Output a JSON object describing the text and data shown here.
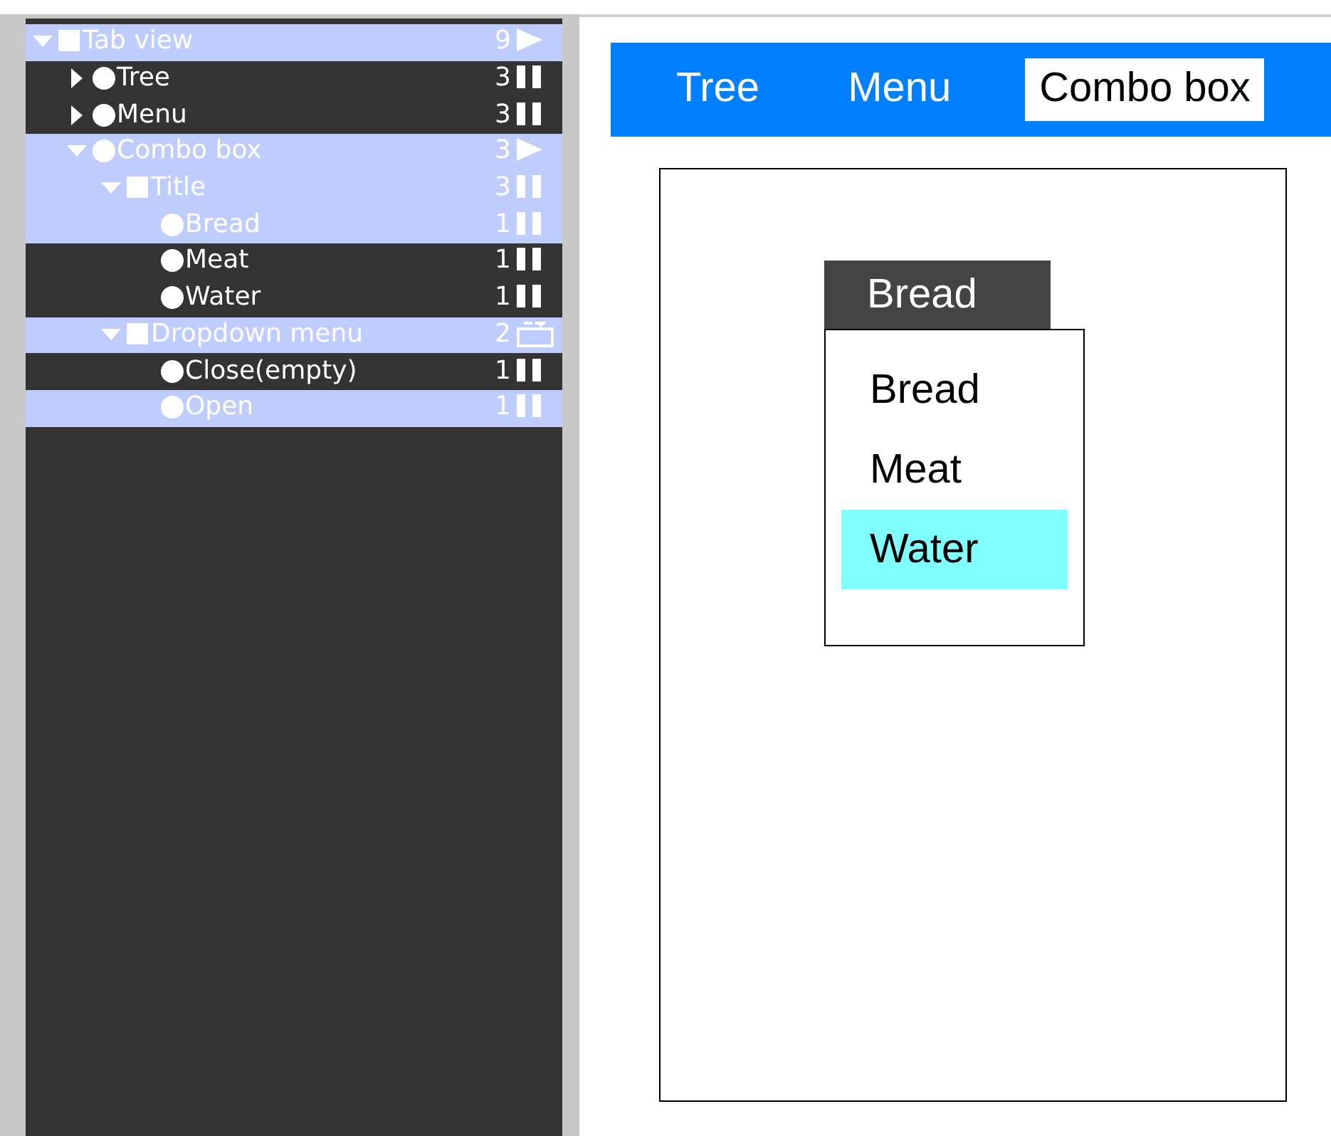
{
  "tree": [
    {
      "label": "Tab view",
      "kind": "square",
      "count": "9",
      "status": {
        "kind": "play"
      },
      "expanded": true,
      "selected": true,
      "children": [
        {
          "label": "Tree",
          "kind": "circle",
          "count": "3",
          "status": {
            "kind": "pause"
          },
          "expanded": false,
          "selected": false
        },
        {
          "label": "Menu",
          "kind": "circle",
          "count": "3",
          "status": {
            "kind": "pause"
          },
          "expanded": false,
          "selected": false
        },
        {
          "label": "Combo box",
          "kind": "circle",
          "count": "3",
          "status": {
            "kind": "play"
          },
          "expanded": true,
          "selected": true,
          "children": [
            {
              "label": "Title",
              "kind": "square",
              "count": "3",
              "status": {
                "kind": "pause"
              },
              "expanded": true,
              "selected": true,
              "children": [
                {
                  "label": "Bread",
                  "kind": "circle",
                  "count": "1",
                  "status": {
                    "kind": "pause"
                  },
                  "selected": true
                },
                {
                  "label": "Meat",
                  "kind": "circle",
                  "count": "1",
                  "status": {
                    "kind": "pause"
                  },
                  "selected": false
                },
                {
                  "label": "Water",
                  "kind": "circle",
                  "count": "1",
                  "status": {
                    "kind": "pause"
                  },
                  "selected": false
                }
              ]
            },
            {
              "label": "Dropdown menu",
              "kind": "square",
              "count": "2",
              "status": {
                "kind": "folder"
              },
              "expanded": true,
              "selected": true,
              "children": [
                {
                  "label": "Close(empty)",
                  "kind": "circle",
                  "count": "1",
                  "status": {
                    "kind": "pause"
                  },
                  "selected": false
                },
                {
                  "label": "Open",
                  "kind": "circle",
                  "count": "1",
                  "status": {
                    "kind": "pause"
                  },
                  "selected": true
                }
              ]
            }
          ]
        }
      ]
    }
  ],
  "tabs": [
    {
      "label": "Tree",
      "selected": false
    },
    {
      "label": "Menu",
      "selected": false
    },
    {
      "label": "Combo box",
      "selected": true
    }
  ],
  "combo": {
    "title": "Bread",
    "options": [
      {
        "label": "Bread",
        "selected": false
      },
      {
        "label": "Meat",
        "selected": false
      },
      {
        "label": "Water",
        "selected": true
      }
    ]
  }
}
